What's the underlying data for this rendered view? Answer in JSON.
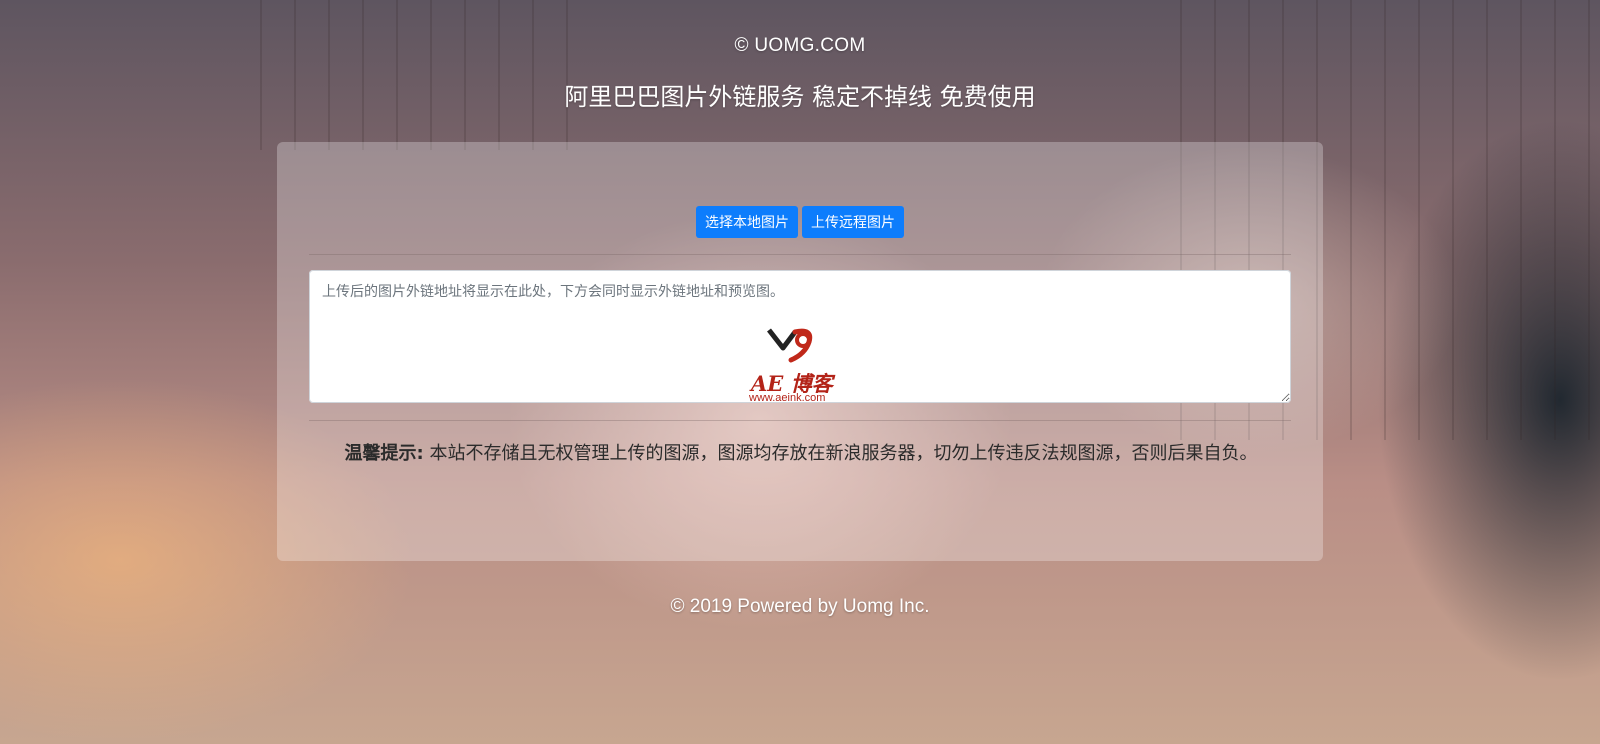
{
  "header": {
    "copyright": "© UOMG.COM",
    "subtitle": "阿里巴巴图片外链服务  稳定不掉线  免费使用"
  },
  "upload": {
    "local_button": "选择本地图片",
    "remote_button": "上传远程图片",
    "result_placeholder": "上传后的图片外链地址将显示在此处，下方会同时显示外链地址和预览图。"
  },
  "watermark": {
    "logo_text": "AE 博客",
    "logo_url": "www.aeink.com"
  },
  "notice": {
    "label": "温馨提示:",
    "text": " 本站不存储且无权管理上传的图源，图源均存放在新浪服务器，切勿上传违反法规图源，否则后果自负。"
  },
  "footer": {
    "text": "© 2019 Powered by Uomg Inc."
  },
  "colors": {
    "button": "#0d7dfc",
    "watermark": "#b32318"
  }
}
